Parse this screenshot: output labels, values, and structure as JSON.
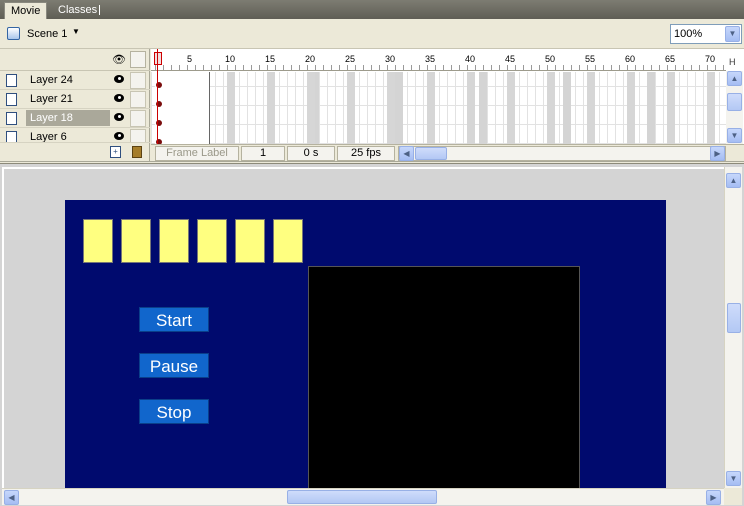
{
  "tabs": [
    {
      "label": "Movie"
    },
    {
      "label": "Classes"
    }
  ],
  "scene": {
    "label": "Scene 1",
    "zoom": "100%"
  },
  "timeline": {
    "ruler_numbers": [
      "5",
      "10",
      "15",
      "20",
      "25",
      "30",
      "35",
      "40",
      "45",
      "50",
      "55",
      "60",
      "65",
      "70"
    ],
    "layers": [
      {
        "name": "Layer 24",
        "selected": false
      },
      {
        "name": "Layer 21",
        "selected": false
      },
      {
        "name": "Layer 18",
        "selected": true
      },
      {
        "name": "Layer 6",
        "selected": false
      }
    ],
    "status": {
      "frame_label": "Frame Label",
      "frame": "1",
      "time": "0 s",
      "fps": "25 fps"
    }
  },
  "stage": {
    "background_color": "#000a6e",
    "yellow_box_count": 6,
    "buttons": [
      {
        "label": "Start"
      },
      {
        "label": "Pause"
      },
      {
        "label": "Stop"
      }
    ]
  },
  "colors": {
    "stage_bg": "#000a6e",
    "yellow_box": "#ffff80",
    "button_bg": "#1166cc",
    "playhead": "#cc0000"
  }
}
